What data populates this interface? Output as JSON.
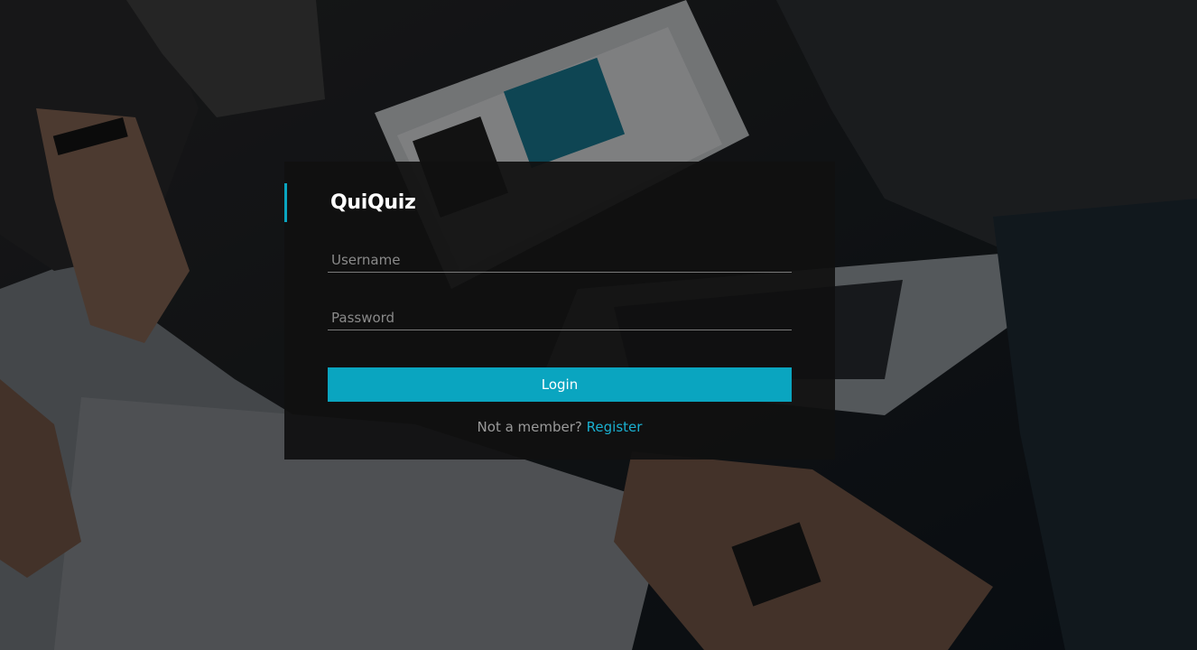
{
  "app": {
    "brand": "QuiQuiz"
  },
  "login_form": {
    "username_placeholder": "Username",
    "password_placeholder": "Password",
    "login_label": "Login",
    "signup_prompt": "Not a member?",
    "register_label": "Register"
  },
  "colors": {
    "accent": "#0aa5c0",
    "link": "#1ab0d0",
    "card_background": "#101010"
  }
}
